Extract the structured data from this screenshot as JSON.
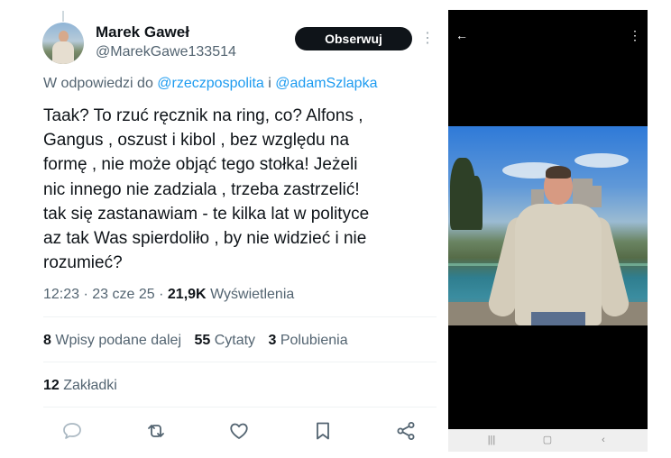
{
  "author": {
    "name": "Marek Gaweł",
    "handle": "@MarekGawe133514",
    "follow_label": "Obserwuj",
    "more_icon": "⋮"
  },
  "reply_to": {
    "prefix": "W odpowiedzi do",
    "mention1": "@rzeczpospolita",
    "joiner": "i",
    "mention2": "@adamSzlapka"
  },
  "text_lines": [
    "Taak? To rzuć ręcznik na ring, co? Alfons ,",
    "Gangus , oszust i kibol , bez względu na",
    "formę , nie  może objąć tego stołka!  Jeżeli",
    "nic innego nie zadziala , trzeba zastrzelić!",
    "tak się zastanawiam - te kilka lat w polityce",
    "az tak Was spierdoliło , by nie widzieć i nie",
    "rozumieć?"
  ],
  "meta": {
    "time": "12:23",
    "date": "23 cze 25",
    "views_count": "21,9K",
    "views_label": "Wyświetlenia",
    "separator": "·"
  },
  "stats": {
    "reposts_count": "8",
    "reposts_label": "Wpisy podane dalej",
    "quotes_count": "55",
    "quotes_label": "Cytaty",
    "likes_count": "3",
    "likes_label": "Polubienia",
    "bookmarks_count": "12",
    "bookmarks_label": "Zakładki"
  },
  "actions": [
    "reply-icon",
    "repost-icon",
    "like-icon",
    "bookmark-icon",
    "share-icon"
  ],
  "phone": {
    "back_icon": "←",
    "menu_icon": "⋮",
    "nav_recent": "|||",
    "nav_home": "▢",
    "nav_back": "‹"
  },
  "colors": {
    "text": "#0f1419",
    "secondary": "#536471",
    "link": "#1d9bf0",
    "button": "#0f1419",
    "icon": "#536471"
  }
}
